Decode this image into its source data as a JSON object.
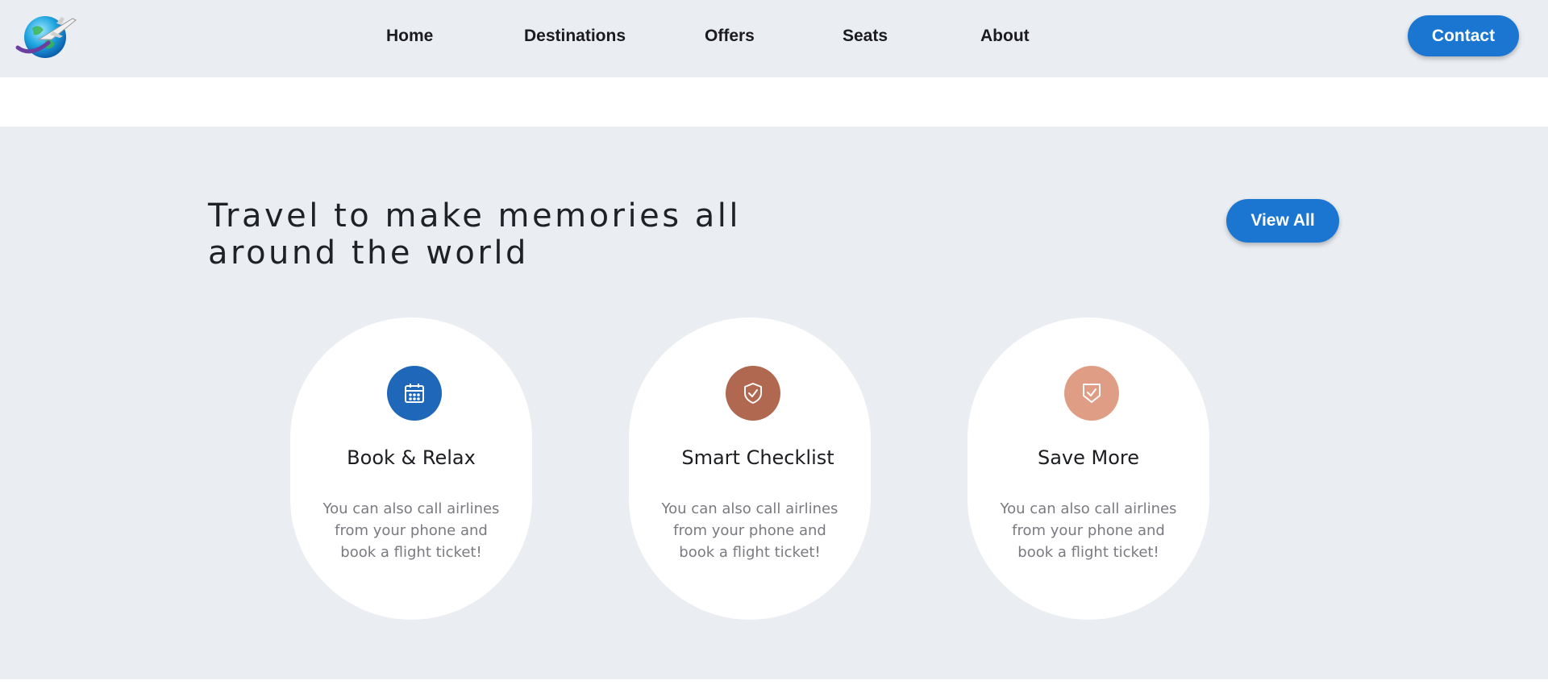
{
  "nav": {
    "items": [
      {
        "label": "Home"
      },
      {
        "label": "Destinations"
      },
      {
        "label": "Offers"
      },
      {
        "label": "Seats"
      },
      {
        "label": "About"
      }
    ],
    "contact_label": "Contact",
    "logo_icon": "globe-airplane-logo"
  },
  "hero": {
    "headline_line1": "Travel to make memories all",
    "headline_line2": "around the world",
    "view_all_label": "View All"
  },
  "cards": [
    {
      "icon": "calendar-icon",
      "color": "#1f67b8",
      "title": "Book & Relax",
      "text": "You can also call airlines from your phone and book a flight ticket!"
    },
    {
      "icon": "shield-check-icon",
      "color": "#b06950",
      "title": "Smart Checklist",
      "text": "You can also call airlines from your phone and book a flight ticket!"
    },
    {
      "icon": "shield-check-icon",
      "color": "#df9d85",
      "title": "Save More",
      "text": "You can also call airlines from your phone and book a flight ticket!"
    }
  ],
  "colors": {
    "accent": "#1b76d2",
    "section_bg": "#eaedf2"
  }
}
